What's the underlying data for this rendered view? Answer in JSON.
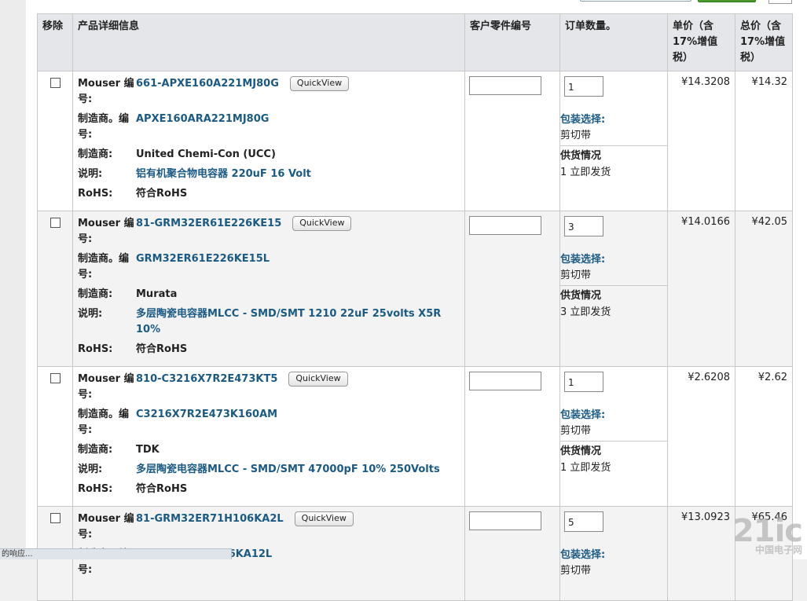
{
  "headers": {
    "remove": "移除",
    "product": "产品详细信息",
    "customer_part": "客户零件编号",
    "qty": "订单数量。",
    "unit_price": "单价（含17%增值税）",
    "total_price": "总价（含17%增值税）"
  },
  "labels": {
    "mouser_no": "Mouser 编号:",
    "mfr_no": "制造商。编号:",
    "mfr": "制造商:",
    "desc": "说明:",
    "rohs": "RoHS:",
    "quickview": "QuickView",
    "pkg": "包装选择:",
    "stock": "供货情况"
  },
  "rows": [
    {
      "mouser_no": "661-APXE160A221MJ80G",
      "mfr_no": "APXE160ARA221MJ80G",
      "mfr": "United Chemi-Con (UCC)",
      "desc": "铝有机聚合物电容器 220uF 16 Volt",
      "rohs": "符合RoHS",
      "qty": "1",
      "pkg": "剪切带",
      "stock": "1 立即发货",
      "unit_price": "¥14.3208",
      "total": "¥14.32"
    },
    {
      "mouser_no": "81-GRM32ER61E226KE15",
      "mfr_no": "GRM32ER61E226KE15L",
      "mfr": "Murata",
      "desc": "多层陶瓷电容器MLCC - SMD/SMT 1210 22uF 25volts X5R 10%",
      "rohs": "符合RoHS",
      "qty": "3",
      "pkg": "剪切带",
      "stock": "3 立即发货",
      "unit_price": "¥14.0166",
      "total": "¥42.05"
    },
    {
      "mouser_no": "810-C3216X7R2E473KT5",
      "mfr_no": "C3216X7R2E473K160AM",
      "mfr": "TDK",
      "desc": "多层陶瓷电容器MLCC - SMD/SMT 47000pF 10% 250Volts",
      "rohs": "符合RoHS",
      "qty": "1",
      "pkg": "剪切带",
      "stock": "1 立即发货",
      "unit_price": "¥2.6208",
      "total": "¥2.62"
    },
    {
      "mouser_no": "81-GRM32ER71H106KA2L",
      "mfr_no": "GRM32ER71H106KA12L",
      "qty": "5",
      "pkg": "剪切带",
      "unit_price": "¥13.0923",
      "total": "¥65.46"
    }
  ],
  "status_text": "的响应...",
  "watermark": {
    "main": "21ic",
    "sub": "中国电子网"
  }
}
